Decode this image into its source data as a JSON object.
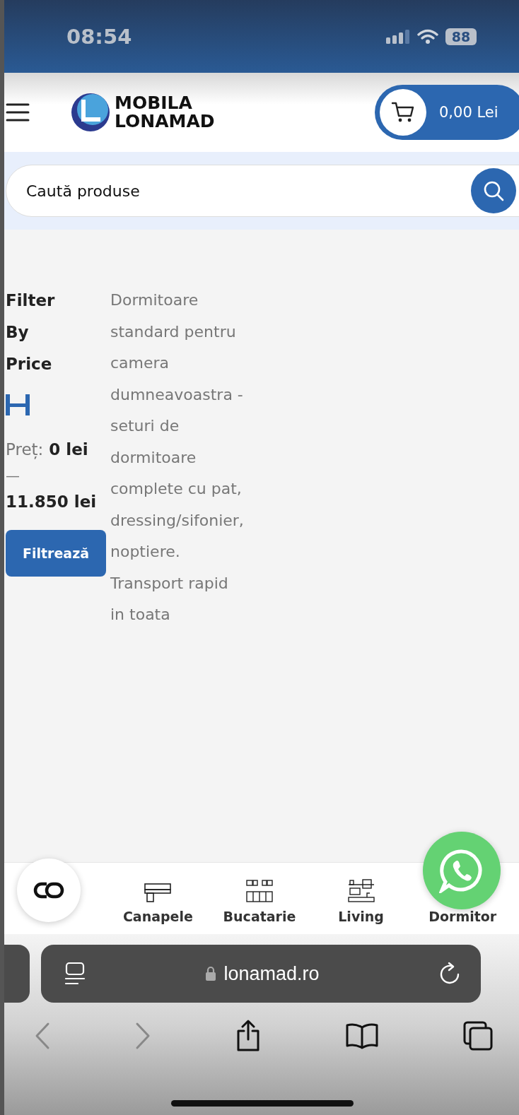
{
  "status_bar": {
    "time": "08:54",
    "battery": "88"
  },
  "header": {
    "brand_lines": [
      "MOBILA",
      "LONAMAD"
    ],
    "cart_total": "0,00 Lei"
  },
  "search": {
    "placeholder": "Caută produse"
  },
  "filter": {
    "title": "Filter By Price",
    "range_handles": [
      {
        "level": 0
      },
      {
        "level": 1
      }
    ],
    "price_label": "Preț:",
    "min": "0 lei",
    "separator": "—",
    "max": "11.850 lei",
    "button": "Filtrează"
  },
  "description": "Dormitoare standard pentru camera dumneavoastra - seturi de dormitoare complete cu pat, dressing/sifonier, noptiere. Transport rapid in toata",
  "bottom_nav": [
    {
      "label": "Canapele",
      "kind": "sofa"
    },
    {
      "label": "Bucatarie",
      "kind": "kitchen"
    },
    {
      "label": "Living",
      "kind": "living"
    },
    {
      "label": "Dormitor"
    }
  ],
  "browser": {
    "url": "lonamad.ro",
    "back_disabled": true,
    "forward_disabled": true
  }
}
